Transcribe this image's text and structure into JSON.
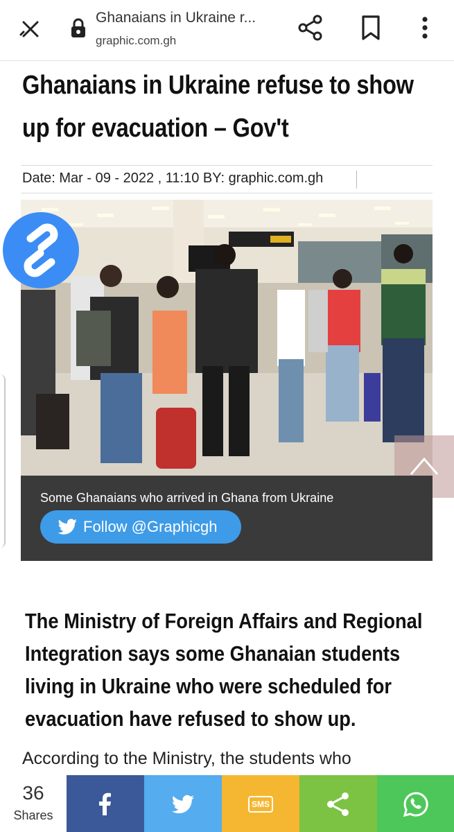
{
  "browser": {
    "tab_title": "Ghanaians in Ukraine r...",
    "url": "graphic.com.gh",
    "icons": [
      "close-icon",
      "lock-icon",
      "share-icon",
      "bookmark-icon",
      "more-vertical-icon"
    ]
  },
  "article": {
    "headline": "Ghanaians in Ukraine refuse to show up for evacuation – Gov't",
    "meta": "Date: Mar - 09 - 2022 , 11:10  BY: graphic.com.gh",
    "photo": {
      "caption": "Some Ghanaians who arrived in Ghana from Ukraine",
      "follow_label": "Follow @Graphicgh"
    },
    "lead": "The Ministry of Foreign Affairs and Regional Integration says some Ghanaian students living in Ukraine who were scheduled for evacuation have refused to show up.",
    "paragraph": "According to the Ministry, the students who"
  },
  "share_bar": {
    "count": "36",
    "count_label": "Shares",
    "sms_label": "SMS",
    "buttons": [
      "facebook-icon",
      "twitter-icon",
      "sms-icon",
      "share-icon",
      "whatsapp-icon"
    ]
  },
  "colors": {
    "shazam": "#3b8df5",
    "caption_bg": "#3a3a3a",
    "follow_btn": "#3e9be8",
    "facebook": "#3b5998",
    "twitter": "#55acee",
    "sms": "#f5b731",
    "share": "#7cc243",
    "whatsapp": "#4ec75a"
  }
}
